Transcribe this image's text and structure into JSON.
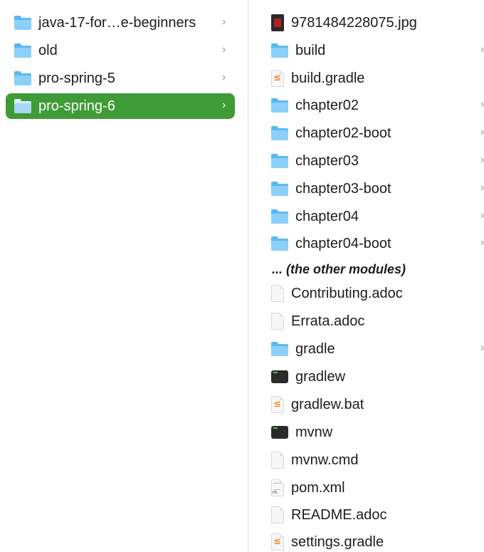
{
  "left_column": {
    "items": [
      {
        "label": "java-17-for…e-beginners",
        "icon": "folder-icon"
      },
      {
        "label": "old",
        "icon": "folder-icon"
      },
      {
        "label": "pro-spring-5",
        "icon": "folder-icon"
      },
      {
        "label": "pro-spring-6",
        "icon": "folder-icon",
        "selected": true
      }
    ],
    "chevron": "›"
  },
  "right_column": {
    "items": [
      {
        "label": "9781484228075.jpg",
        "icon": "image-thumbnail-icon"
      },
      {
        "label": "build",
        "icon": "folder-icon"
      },
      {
        "label": "build.gradle",
        "icon": "gradle-file-icon"
      },
      {
        "label": "chapter02",
        "icon": "folder-icon"
      },
      {
        "label": "chapter02-boot",
        "icon": "folder-icon"
      },
      {
        "label": "chapter03",
        "icon": "folder-icon"
      },
      {
        "label": "chapter03-boot",
        "icon": "folder-icon"
      },
      {
        "label": "chapter04",
        "icon": "folder-icon"
      },
      {
        "label": "chapter04-boot",
        "icon": "folder-icon"
      },
      {
        "label": "Contributing.adoc",
        "icon": "document-icon"
      },
      {
        "label": "Errata.adoc",
        "icon": "document-icon"
      },
      {
        "label": "gradle",
        "icon": "folder-icon"
      },
      {
        "label": "gradlew",
        "icon": "terminal-file-icon"
      },
      {
        "label": "gradlew.bat",
        "icon": "gradle-file-icon"
      },
      {
        "label": "mvnw",
        "icon": "terminal-file-icon"
      },
      {
        "label": "mvnw.cmd",
        "icon": "document-icon"
      },
      {
        "label": "pom.xml",
        "icon": "xml-file-icon"
      },
      {
        "label": "README.adoc",
        "icon": "document-icon"
      },
      {
        "label": "settings.gradle",
        "icon": "gradle-file-icon"
      }
    ],
    "note": "... (the other modules)",
    "chevron": "›"
  },
  "colors": {
    "selection": "#3f9b36",
    "folder": "#5cb9f1",
    "gradle_glyph": "#f08b1b"
  }
}
